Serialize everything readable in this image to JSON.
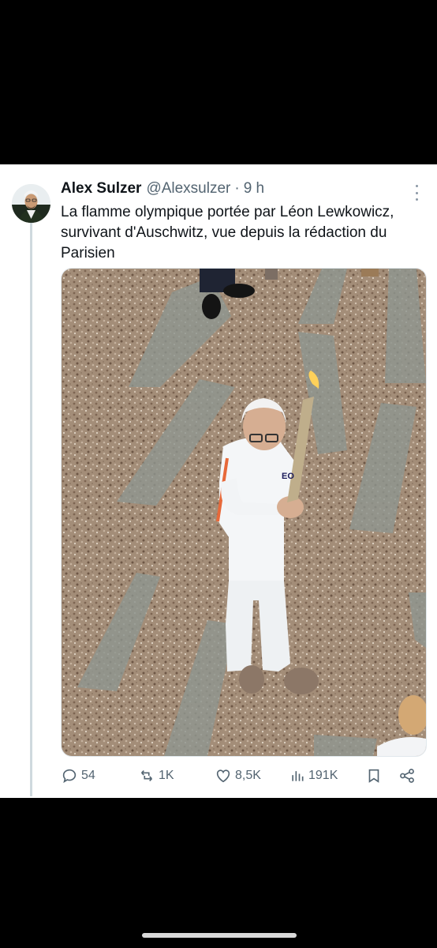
{
  "tweet": {
    "author_name": "Alex Sulzer",
    "author_handle": "@Alexsulzer",
    "separator": "·",
    "time": "9 h",
    "text_lines": [
      "La flamme olympique portée par Léon Lewkowicz,",
      "survivant d'Auschwitz, vue depuis la rédaction du",
      "Parisien"
    ],
    "photo_text": "EO"
  },
  "actions": {
    "replies": "54",
    "reposts": "1K",
    "likes": "8,5K",
    "views": "191K"
  },
  "icons": [
    "reply-icon",
    "repost-icon",
    "like-icon",
    "views-icon",
    "bookmark-icon",
    "share-icon",
    "more-icon"
  ],
  "colors": {
    "background": "#000000",
    "card": "#ffffff",
    "text": "#0f1419",
    "muted": "#536471"
  }
}
